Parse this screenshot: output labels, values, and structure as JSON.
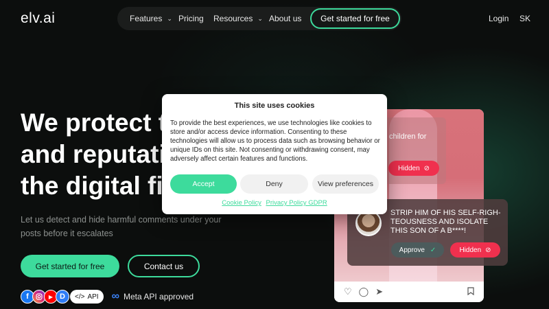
{
  "brand": {
    "logo": "elv.ai"
  },
  "nav": {
    "items": [
      {
        "label": "Features",
        "has_dropdown": true
      },
      {
        "label": "Pricing",
        "has_dropdown": false
      },
      {
        "label": "Resources",
        "has_dropdown": true
      },
      {
        "label": "About us",
        "has_dropdown": false
      }
    ],
    "cta": "Get started for free",
    "login": "Login",
    "language": "SK"
  },
  "hero": {
    "title_line1": "We protect t",
    "title_line2": "and reputati",
    "title_line3": "the digital fi",
    "subtitle": "Let us detect and hide harmful comments under your posts before it escalates",
    "primary_button": "Get started for free",
    "secondary_button": "Contact us",
    "api_badge": "API",
    "meta_badge": "Meta API approved"
  },
  "preview": {
    "comment1_text": "children for",
    "comment1_action": "Hidden",
    "comment2_text": "STRIP HIM OF HIS SELF-RIGH-TEOUSNESS AND ISOLATE THIS SON OF A B****!",
    "approve_label": "Approve",
    "hidden_label": "Hidden"
  },
  "cookie": {
    "title": "This site uses cookies",
    "body": "To provide the best experiences, we use technologies like cookies to store and/or access device information. Consenting to these technologies will allow us to process data such as browsing behavior or unique IDs on this site. Not consenting or withdrawing consent, may adversely affect certain features and functions.",
    "accept": "Accept",
    "deny": "Deny",
    "view_preferences": "View preferences",
    "link_cookie_policy": "Cookie Policy",
    "link_privacy_policy": "Privacy Policy GDPR"
  },
  "colors": {
    "accent": "#3ddb9c",
    "danger": "#f0304e",
    "background": "#0c0e0d"
  }
}
